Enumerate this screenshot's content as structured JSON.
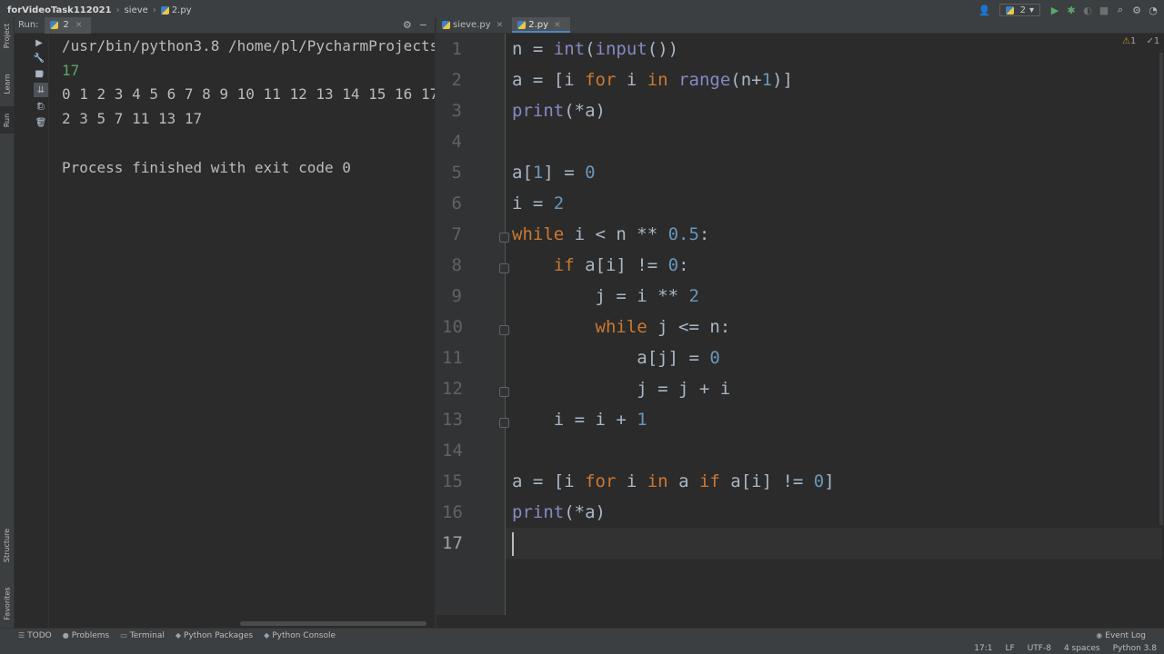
{
  "navbar": {
    "project": "forVideoTask11202​1",
    "folder": "sieve",
    "file": "2.py"
  },
  "toolbar": {
    "run_config": "2"
  },
  "left_strip": {
    "project_tab": "Project",
    "learn_tab": "Learn",
    "run_tab": "Run",
    "structure_tab": "Structure",
    "favorites_tab": "Favorites"
  },
  "run_panel": {
    "label": "Run:",
    "tab_name": "2",
    "console_lines": [
      "/usr/bin/python3.8 /home/pl/PycharmProjects/f",
      "17",
      "0 1 2 3 4 5 6 7 8 9 10 11 12 13 14 15 16 17",
      "2 3 5 7 11 13 17",
      "",
      "Process finished with exit code 0"
    ]
  },
  "editor": {
    "tabs": [
      {
        "label": "sieve.py",
        "active": false
      },
      {
        "label": "2.py",
        "active": true
      }
    ],
    "line_numbers": [
      "1",
      "2",
      "3",
      "4",
      "5",
      "6",
      "7",
      "8",
      "9",
      "10",
      "11",
      "12",
      "13",
      "14",
      "15",
      "16",
      "17"
    ],
    "current_line": 17,
    "code": [
      [
        [
          "t",
          "n = "
        ],
        [
          "b",
          "int"
        ],
        [
          "t",
          "("
        ],
        [
          "b",
          "input"
        ],
        [
          "t",
          "())"
        ]
      ],
      [
        [
          "t",
          "a = [i "
        ],
        [
          "k",
          "for"
        ],
        [
          "t",
          " i "
        ],
        [
          "k",
          "in"
        ],
        [
          "t",
          " "
        ],
        [
          "b",
          "range"
        ],
        [
          "t",
          "(n+"
        ],
        [
          "n",
          "1"
        ],
        [
          "t",
          ")]"
        ]
      ],
      [
        [
          "b",
          "print"
        ],
        [
          "t",
          "(*a)"
        ]
      ],
      [],
      [
        [
          "t",
          "a["
        ],
        [
          "n",
          "1"
        ],
        [
          "t",
          "] = "
        ],
        [
          "n",
          "0"
        ]
      ],
      [
        [
          "t",
          "i = "
        ],
        [
          "n",
          "2"
        ]
      ],
      [
        [
          "k",
          "while"
        ],
        [
          "t",
          " i < n ** "
        ],
        [
          "n",
          "0.5"
        ],
        [
          "t",
          ":"
        ]
      ],
      [
        [
          "t",
          "    "
        ],
        [
          "k",
          "if"
        ],
        [
          "t",
          " a[i] != "
        ],
        [
          "n",
          "0"
        ],
        [
          "t",
          ":"
        ]
      ],
      [
        [
          "t",
          "        j = i ** "
        ],
        [
          "n",
          "2"
        ]
      ],
      [
        [
          "t",
          "        "
        ],
        [
          "k",
          "while"
        ],
        [
          "t",
          " j <= n:"
        ]
      ],
      [
        [
          "t",
          "            a[j] = "
        ],
        [
          "n",
          "0"
        ]
      ],
      [
        [
          "t",
          "            j = j + i"
        ]
      ],
      [
        [
          "t",
          "    i = i + "
        ],
        [
          "n",
          "1"
        ]
      ],
      [],
      [
        [
          "t",
          "a = [i "
        ],
        [
          "k",
          "for"
        ],
        [
          "t",
          " i "
        ],
        [
          "k",
          "in"
        ],
        [
          "t",
          " a "
        ],
        [
          "k",
          "if"
        ],
        [
          "t",
          " a[i] != "
        ],
        [
          "n",
          "0"
        ],
        [
          "t",
          "]"
        ]
      ],
      [
        [
          "b",
          "print"
        ],
        [
          "t",
          "(*a)"
        ]
      ],
      []
    ],
    "inspection": {
      "warnings": "1",
      "weak": "1"
    }
  },
  "bottom_tabs": {
    "todo": "TODO",
    "problems": "Problems",
    "terminal": "Terminal",
    "python_packages": "Python Packages",
    "python_console": "Python Console",
    "event_log": "Event Log"
  },
  "status": {
    "position": "17:1",
    "line_sep": "LF",
    "encoding": "UTF-8",
    "indent": "4 spaces",
    "interpreter": "Python 3.8"
  },
  "colors": {
    "keyword": "#cc7832",
    "number": "#6897bb",
    "builtin": "#8888c6",
    "text": "#a9b7c6",
    "console_input": "#59a869"
  }
}
